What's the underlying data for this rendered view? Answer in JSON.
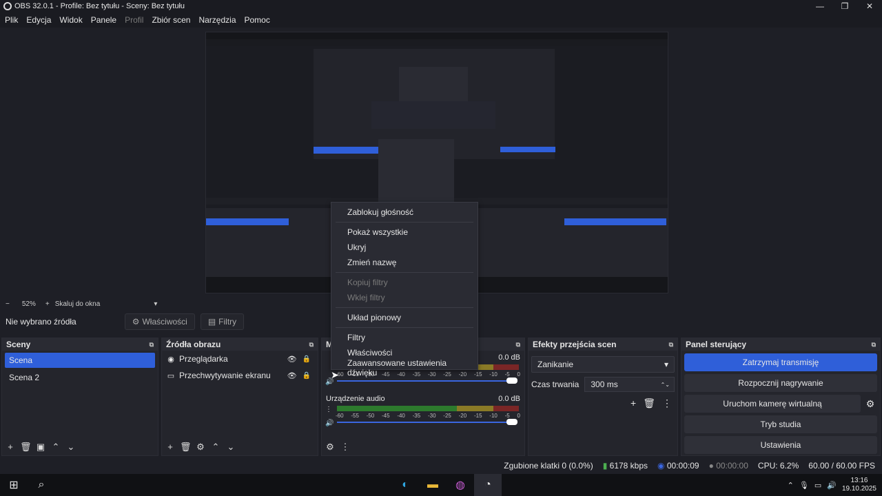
{
  "window": {
    "title": "OBS 32.0.1 - Profile: Bez tytułu - Sceny: Bez tytułu",
    "min": "—",
    "max": "❐",
    "close": "✕"
  },
  "menu": [
    "Plik",
    "Edycja",
    "Widok",
    "Panele",
    "Profil",
    "Zbiór scen",
    "Narzędzia",
    "Pomoc"
  ],
  "zoom": {
    "minus": "−",
    "value": "52%",
    "plus": "+",
    "mode": "Skaluj do okna",
    "dropdown": "▾"
  },
  "source_bar": {
    "label": "Nie wybrano źródła",
    "properties": "Właściwości",
    "filters": "Filtry"
  },
  "scenes": {
    "title": "Sceny",
    "items": [
      "Scena",
      "Scena 2"
    ]
  },
  "sources": {
    "title": "Źródła obrazu",
    "items": [
      "Przeglądarka",
      "Przechwytywanie ekranu"
    ]
  },
  "mixer": {
    "title_partial": "M",
    "channel1_db": "0.0 dB",
    "channel2_name": "Urządzenie audio",
    "channel2_db": "0.0 dB",
    "ticks": [
      "-60",
      "-55",
      "-50",
      "-45",
      "-40",
      "-35",
      "-30",
      "-25",
      "-20",
      "-15",
      "-10",
      "-5",
      "0"
    ]
  },
  "transitions": {
    "title": "Efekty przejścia scen",
    "selected": "Zanikanie",
    "duration_label": "Czas trwania",
    "duration_value": "300 ms"
  },
  "controls": {
    "title": "Panel sterujący",
    "buttons": [
      "Zatrzymaj transmisję",
      "Rozpocznij nagrywanie",
      "Uruchom kamerę wirtualną",
      "Tryb studia",
      "Ustawienia"
    ]
  },
  "status": {
    "dropped": "Zgubione klatki 0 (0.0%)",
    "kbps": "6178 kbps",
    "stream_time": "00:00:09",
    "rec_time": "00:00:00",
    "cpu": "CPU: 6.2%",
    "fps": "60.00 / 60.00 FPS"
  },
  "context_menu": {
    "items": [
      {
        "label": "Zablokuj głośność",
        "enabled": true
      },
      {
        "label": "Pokaż wszystkie",
        "enabled": true
      },
      {
        "label": "Ukryj",
        "enabled": true
      },
      {
        "label": "Zmień nazwę",
        "enabled": true
      },
      {
        "label": "Kopiuj filtry",
        "enabled": false
      },
      {
        "label": "Wklej filtry",
        "enabled": false
      },
      {
        "label": "Układ pionowy",
        "enabled": true
      },
      {
        "label": "Filtry",
        "enabled": true
      },
      {
        "label": "Właściwości",
        "enabled": true
      },
      {
        "label": "Zaawansowane ustawienia dźwięku",
        "enabled": true
      }
    ]
  },
  "clock": {
    "time": "13:16",
    "date": "19.10.2025"
  }
}
